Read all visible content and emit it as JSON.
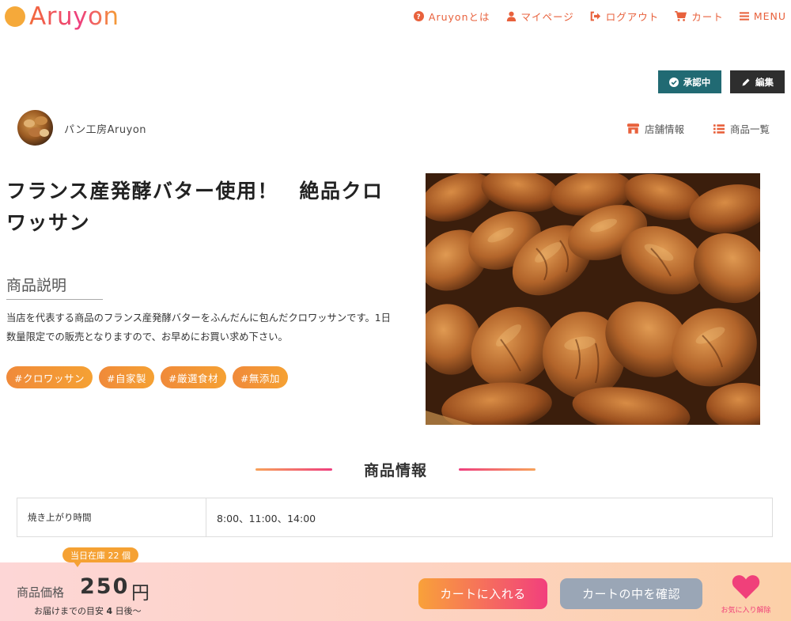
{
  "header": {
    "logo_text": "Aruyon",
    "logo_mark_text": "Aruyon",
    "nav": [
      {
        "label": "Aruyonとは",
        "icon": "question-circle-icon"
      },
      {
        "label": "マイページ",
        "icon": "user-icon"
      },
      {
        "label": "ログアウト",
        "icon": "sign-out-icon"
      },
      {
        "label": "カート",
        "icon": "cart-icon"
      },
      {
        "label": "MENU",
        "icon": "menu-icon"
      }
    ]
  },
  "status": {
    "approved_label": "承認中",
    "edit_label": "編集"
  },
  "shop": {
    "name": "パン工房Aruyon",
    "shop_info_label": "店舗情報",
    "product_list_label": "商品一覧"
  },
  "product": {
    "title": "フランス産発酵バター使用！　絶品クロワッサン",
    "description_heading": "商品説明",
    "description": "当店を代表する商品のフランス産発酵バターをふんだんに包んだクロワッサンです。1日数量限定での販売となりますので、お早めにお買い求め下さい。",
    "tags": [
      "#クロワッサン",
      "#自家製",
      "#厳選食材",
      "#無添加"
    ]
  },
  "info": {
    "heading": "商品情報",
    "rows": [
      {
        "label": "焼き上がり時間",
        "value": "8:00、11:00、14:00"
      }
    ]
  },
  "purchase": {
    "stock_badge": "当日在庫 22 個",
    "price_label": "商品価格",
    "price": "250",
    "price_unit": "円",
    "delivery_prefix": "お届けまでの目安",
    "delivery_days": "4",
    "delivery_suffix": "日後〜",
    "add_to_cart_label": "カートに入れる",
    "view_cart_label": "カートの中を確認",
    "favorite_label": "お気に入り解除"
  },
  "colors": {
    "accent_orange": "#e8613c",
    "approved_bg": "#216a73",
    "edit_bg": "#2e2e2e",
    "tag_orange": "#f5a133",
    "cart_gradient_start": "#f9a13a",
    "cart_gradient_end": "#f23f7d",
    "view_cart_bg": "#9aa6b6",
    "heart_pink": "#f0407a"
  }
}
